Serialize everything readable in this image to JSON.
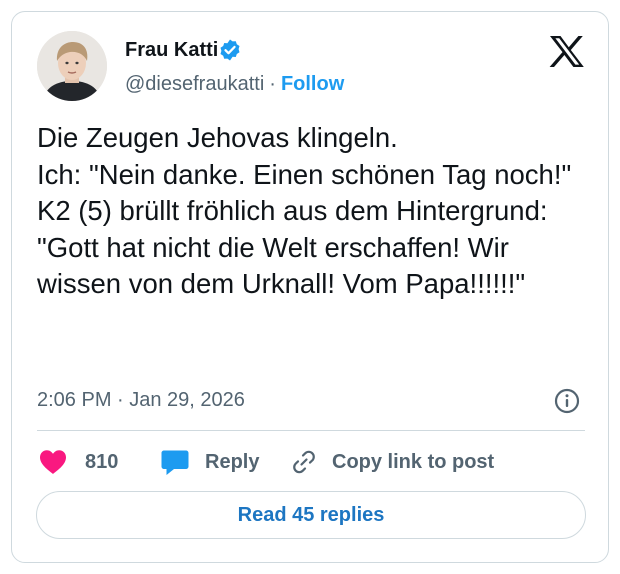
{
  "author": {
    "display_name": "Frau Katti",
    "handle": "@diesefraukatti",
    "separator": "·",
    "follow_label": "Follow"
  },
  "tweet": {
    "text": "Die Zeugen Jehovas klingeln.\nIch: \"Nein danke. Einen schönen Tag noch!\"\nK2 (5) brüllt fröhlich aus dem Hintergrund: \"Gott hat nicht die Welt erschaffen! Wir wissen von dem Urknall! Vom Papa!!!!!!\"",
    "timestamp": "2:06 PM · Jan 29, 2026"
  },
  "actions": {
    "like_count": "810",
    "reply_label": "Reply",
    "copy_label": "Copy link to post"
  },
  "footer": {
    "read_replies_label": "Read 45 replies"
  },
  "icons": {
    "verified": "verified-badge-icon",
    "logo": "x-logo-icon",
    "info": "info-icon",
    "like": "heart-icon",
    "reply": "speech-bubble-icon",
    "copy": "link-icon"
  },
  "colors": {
    "accent": "#1d9bf0",
    "like": "#f91880",
    "text": "#0f1419",
    "muted": "#536471",
    "border": "#cfd9de"
  }
}
